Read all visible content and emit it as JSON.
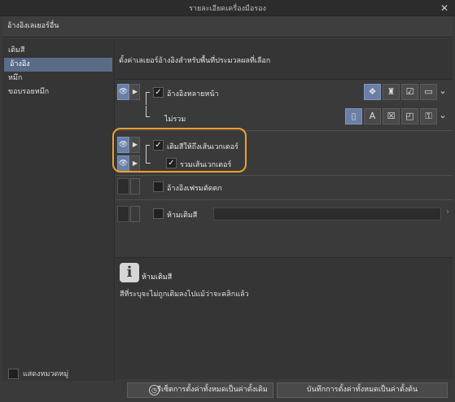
{
  "window": {
    "title": "รายละเอียดเครื่องมือรอง",
    "close": "✕"
  },
  "header": {
    "title": "อ้างอิงเลเยอร์อื่น"
  },
  "sidebar": {
    "items": [
      {
        "label": "เติมสี",
        "active": false
      },
      {
        "label": "อ้างอิง",
        "active": true
      },
      {
        "label": "หมึก",
        "active": false
      },
      {
        "label": "ขอบรอยหมึก",
        "active": false
      }
    ],
    "show_all_label": "แสดงหมวดหมู่"
  },
  "main": {
    "description": "ตั้งค่าเลเยอร์อ้างอิงสำหรับพื้นที่ประมวลผลที่เลือก",
    "rows": {
      "multi_ref": {
        "label": "อ้างอิงหลายหน้า",
        "checked": true
      },
      "exclude": {
        "label": "ไม่รวม"
      },
      "fill_to_vector": {
        "label": "เติมสีให้ถึงเส้นเวกเตอร์",
        "checked": true
      },
      "include_vector": {
        "label": "รวมเส้นเวกเตอร์",
        "checked": true
      },
      "ref_frames": {
        "label": "อ้างอิงเฟรมตัดตก",
        "checked": false
      },
      "no_fill": {
        "label": "ห้ามเติมสี",
        "checked": false
      }
    },
    "info": {
      "title": "ห้ามเติมสี",
      "text": "สีที่ระบุจะไม่ถูกเติมลงไปแม้ว่าจะคลิกแล้ว"
    }
  },
  "footer": {
    "reset_label": "รีเซ็ตการตั้งค่าทั้งหมดเป็นค่าดั้งเดิม",
    "save_label": "บันทึกการตั้งค่าทั้งหมดเป็นค่าตั้งต้น"
  },
  "colors": {
    "accent": "#6a7fa6",
    "highlight": "#f0a030"
  }
}
